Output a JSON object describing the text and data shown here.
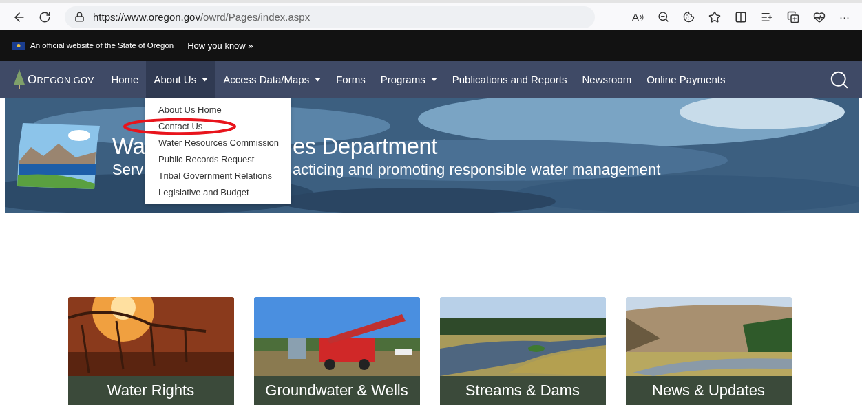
{
  "browser": {
    "url_host": "https://www.oregon.gov",
    "url_path": "/owrd/Pages/index.aspx",
    "read_aloud": "A",
    "more": "···"
  },
  "gov_banner": {
    "text": "An official website of the State of Oregon",
    "link": "How you know »"
  },
  "nav": {
    "logo": "OREGON.GOV",
    "items": [
      {
        "label": "Home",
        "selected": false,
        "has_menu": false
      },
      {
        "label": "About Us",
        "selected": true,
        "has_menu": true
      },
      {
        "label": "Access Data/Maps",
        "selected": false,
        "has_menu": true
      },
      {
        "label": "Forms",
        "selected": false,
        "has_menu": false
      },
      {
        "label": "Programs",
        "selected": false,
        "has_menu": true
      },
      {
        "label": "Publications and Reports",
        "selected": false,
        "has_menu": false
      },
      {
        "label": "Newsroom",
        "selected": false,
        "has_menu": false
      },
      {
        "label": "Online Payments",
        "selected": false,
        "has_menu": false
      }
    ]
  },
  "dropdown": {
    "items": [
      {
        "label": "About Us Home",
        "circled": false
      },
      {
        "label": "Contact Us",
        "circled": true
      },
      {
        "label": "Water Resources Commission",
        "circled": false
      },
      {
        "label": "Public Records Request",
        "circled": false
      },
      {
        "label": "Tribal Government Relations",
        "circled": false
      },
      {
        "label": "Legislative and Budget",
        "circled": false
      }
    ]
  },
  "hero": {
    "title_parts": [
      "Wa",
      "es Department"
    ],
    "subtitle_parts": [
      "Serv",
      "acticing and promoting responsible water management"
    ]
  },
  "cards": [
    {
      "label": "Water Rights"
    },
    {
      "label": "Groundwater & Wells"
    },
    {
      "label": "Streams & Dams"
    },
    {
      "label": "News & Updates"
    }
  ]
}
